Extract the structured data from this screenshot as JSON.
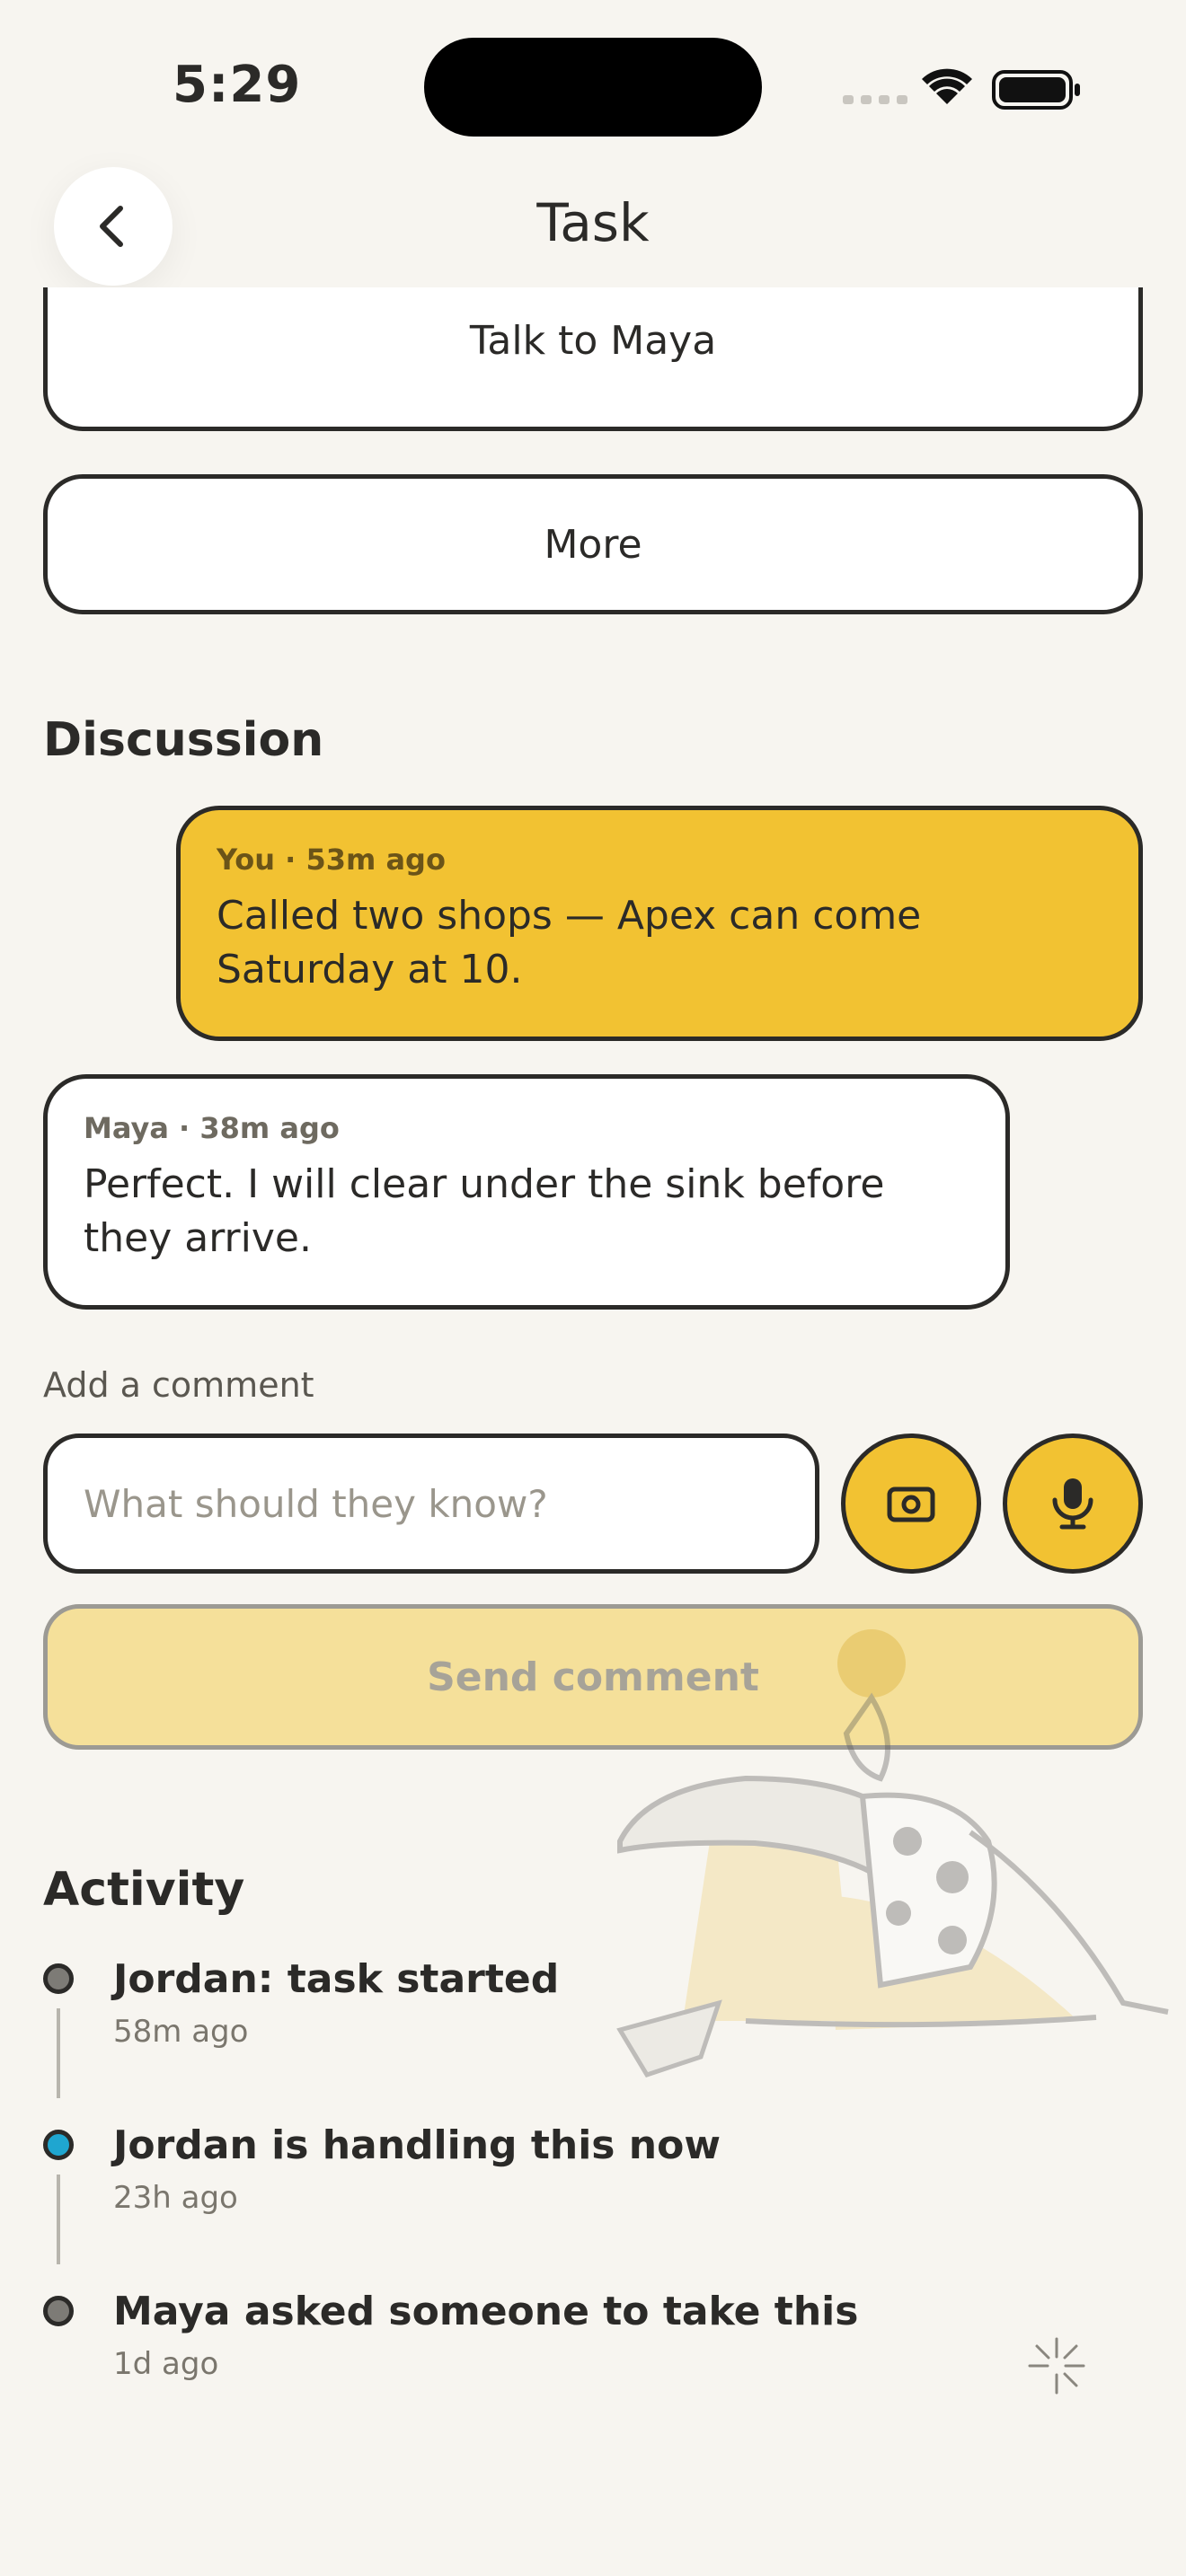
{
  "status_bar": {
    "time": "5:29"
  },
  "nav": {
    "title": "Task"
  },
  "actions": {
    "talk_label": "Talk to Maya",
    "more_label": "More"
  },
  "discussion": {
    "title": "Discussion",
    "messages": [
      {
        "author": "You",
        "time": "53m ago",
        "meta": "You · 53m ago",
        "text": "Called two shops — Apex can come Saturday at 10."
      },
      {
        "author": "Maya",
        "time": "38m ago",
        "meta": "Maya · 38m ago",
        "text": "Perfect. I will clear under the sink before they arrive."
      }
    ]
  },
  "comment": {
    "label": "Add a comment",
    "placeholder": "What should they know?",
    "value": "",
    "send_label": "Send comment",
    "send_enabled": false
  },
  "activity": {
    "title": "Activity",
    "items": [
      {
        "title": "Jordan: task started",
        "time": "58m ago",
        "active": false
      },
      {
        "title": "Jordan is handling this now",
        "time": "23h ago",
        "active": true
      },
      {
        "title": "Maya asked someone to take this",
        "time": "1d ago",
        "active": false
      }
    ]
  },
  "colors": {
    "accent": "#f2c232",
    "background": "#f7f5f0",
    "active_dot": "#1fa6d0",
    "ink": "#2b2a28"
  },
  "icons": [
    "chevron-left-icon",
    "camera-icon",
    "microphone-icon",
    "wifi-icon",
    "battery-icon",
    "signal-icon",
    "sparkle-icon"
  ]
}
